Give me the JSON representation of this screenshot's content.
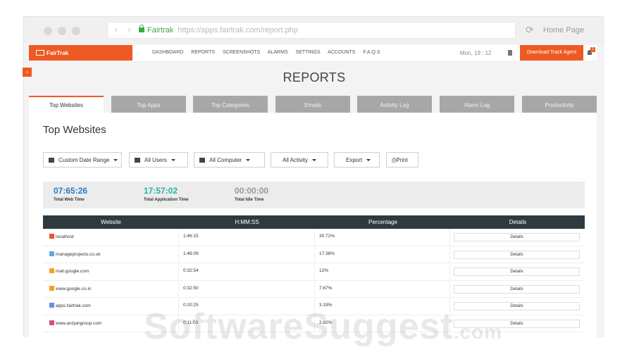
{
  "browser": {
    "site_name": "Fairtrak",
    "url": "https://apps.fairtrak.com/report.php",
    "home_label": "Home Page"
  },
  "topnav": {
    "logo_text": "FairTrak",
    "menu": [
      "DASHBOARD",
      "REPORTS",
      "SCREENSHOTS",
      "ALARMS",
      "SETTINGS",
      "ACCOUNTS",
      "F.A.Q.S"
    ],
    "clock": "Mon, 19 : 12",
    "download_label": "Download Track Agent",
    "notification_count": "2",
    "brand_color": "#ee5a24"
  },
  "page_title": "REPORTS",
  "tabs": [
    "Top Websites",
    "Top Apps",
    "Top Categories",
    "Emails",
    "Activity Log",
    "Alarm Log",
    "Productivity"
  ],
  "active_tab": "Top Websites",
  "section_title": "Top Websites",
  "filters": {
    "date_range": "Custom Date Range",
    "users": "All Users",
    "computer": "All Computer",
    "activity": "All Activity",
    "export": "Export",
    "print": "Print"
  },
  "stats": [
    {
      "value": "07:65:26",
      "label": "Total Web Time",
      "color": "#2a7bbf"
    },
    {
      "value": "17:57:02",
      "label": "Total Application Time",
      "color": "#22b5a5"
    },
    {
      "value": "00:00:00",
      "label": "Total Idle Time",
      "color": "#999999"
    }
  ],
  "table": {
    "headers": [
      "Website",
      "H:MM:SS",
      "Percentage",
      "Details"
    ],
    "rows": [
      {
        "website": "localhost",
        "time": "1:46:15",
        "percentage": "30.72%",
        "details": "Details",
        "color": "#e8552a"
      },
      {
        "website": "manageprojects.co.uk",
        "time": "1:46:09",
        "percentage": "17.38%",
        "details": "Details",
        "color": "#5fa8e0"
      },
      {
        "website": "mail.google.com",
        "time": "0:32:54",
        "percentage": "12%",
        "details": "Details",
        "color": "#f4a21b"
      },
      {
        "website": "www.google.co.in",
        "time": "0:32:50",
        "percentage": "7.67%",
        "details": "Details",
        "color": "#f4a21b"
      },
      {
        "website": "apps.fairtrak.com",
        "time": "0:20:25",
        "percentage": "3.19%",
        "details": "Details",
        "color": "#6b8fd8"
      },
      {
        "website": "www.anzjangroup.com",
        "time": "0:11:03",
        "percentage": "2.82%",
        "details": "Details",
        "color": "#d94f7a"
      }
    ]
  },
  "watermark": {
    "main": "SoftwareSuggest",
    "suffix": ".com"
  }
}
